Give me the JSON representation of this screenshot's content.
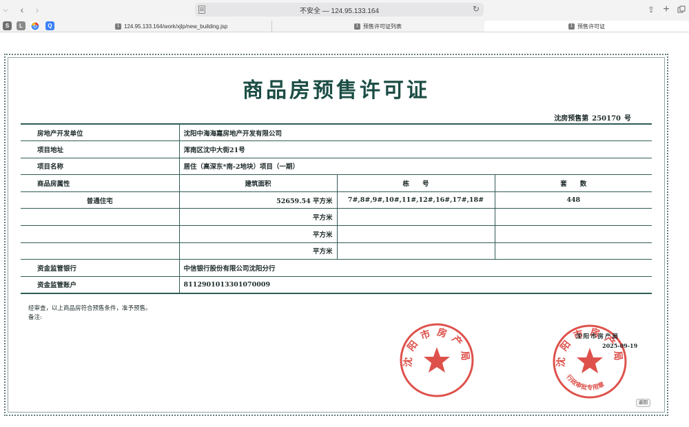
{
  "browser": {
    "address": "不安全 — 124.95.133.164",
    "tabs": [
      {
        "label": "124.95.133.164/work/xjlp/new_building.jsp",
        "active": false
      },
      {
        "label": "预售许可证列表",
        "active": false
      },
      {
        "label": "预售许可证",
        "active": true
      }
    ],
    "favorites": [
      {
        "label": "S",
        "color": "#6e6e6e"
      },
      {
        "label": "L",
        "color": "#8a8a8a"
      },
      {
        "label": "",
        "color": "#4a8cf0"
      },
      {
        "label": "Q",
        "color": "#3b82f6"
      }
    ]
  },
  "certificate": {
    "title": "商品房预售许可证",
    "number_prefix": "沈房预售第",
    "number": "250170",
    "number_suffix": "号",
    "developer_label": "房地产开发单位",
    "developer": "沈阳中海海嘉房地产开发有限公司",
    "address_label": "项目地址",
    "address": "浑南区沈中大街21号",
    "project_label": "项目名称",
    "project": "居住（高深东*南-2地块）项目（一期）",
    "headers": {
      "attribute": "商品房属性",
      "area": "建筑面积",
      "building": "栋　　号",
      "units": "套　　数"
    },
    "rows": [
      {
        "attribute": "普通住宅",
        "area": "52659.54 平方米",
        "buildings": "7#,8#,9#,10#,11#,12#,16#,17#,18#",
        "units": "448"
      },
      {
        "attribute": "",
        "area": "平方米",
        "buildings": "",
        "units": ""
      },
      {
        "attribute": "",
        "area": "平方米",
        "buildings": "",
        "units": ""
      },
      {
        "attribute": "",
        "area": "平方米",
        "buildings": "",
        "units": ""
      }
    ],
    "bank_label": "资金监管银行",
    "bank": "中信银行股份有限公司沈阳分行",
    "account_label": "资金监管账户",
    "account": "8112901013301070009",
    "approval_note": "经审查，以上商品房符合预售条件，准予预售。",
    "remark_label": "备注:",
    "office": "沈阳市房产局",
    "date": "2025-09-19",
    "stamp1_text": "沈阳市房产局",
    "stamp2_text": "沈阳市房产局",
    "stamp2_bottom": "行政审批专用章",
    "back_button": "返回",
    "stamp_color": "#d8322b"
  }
}
